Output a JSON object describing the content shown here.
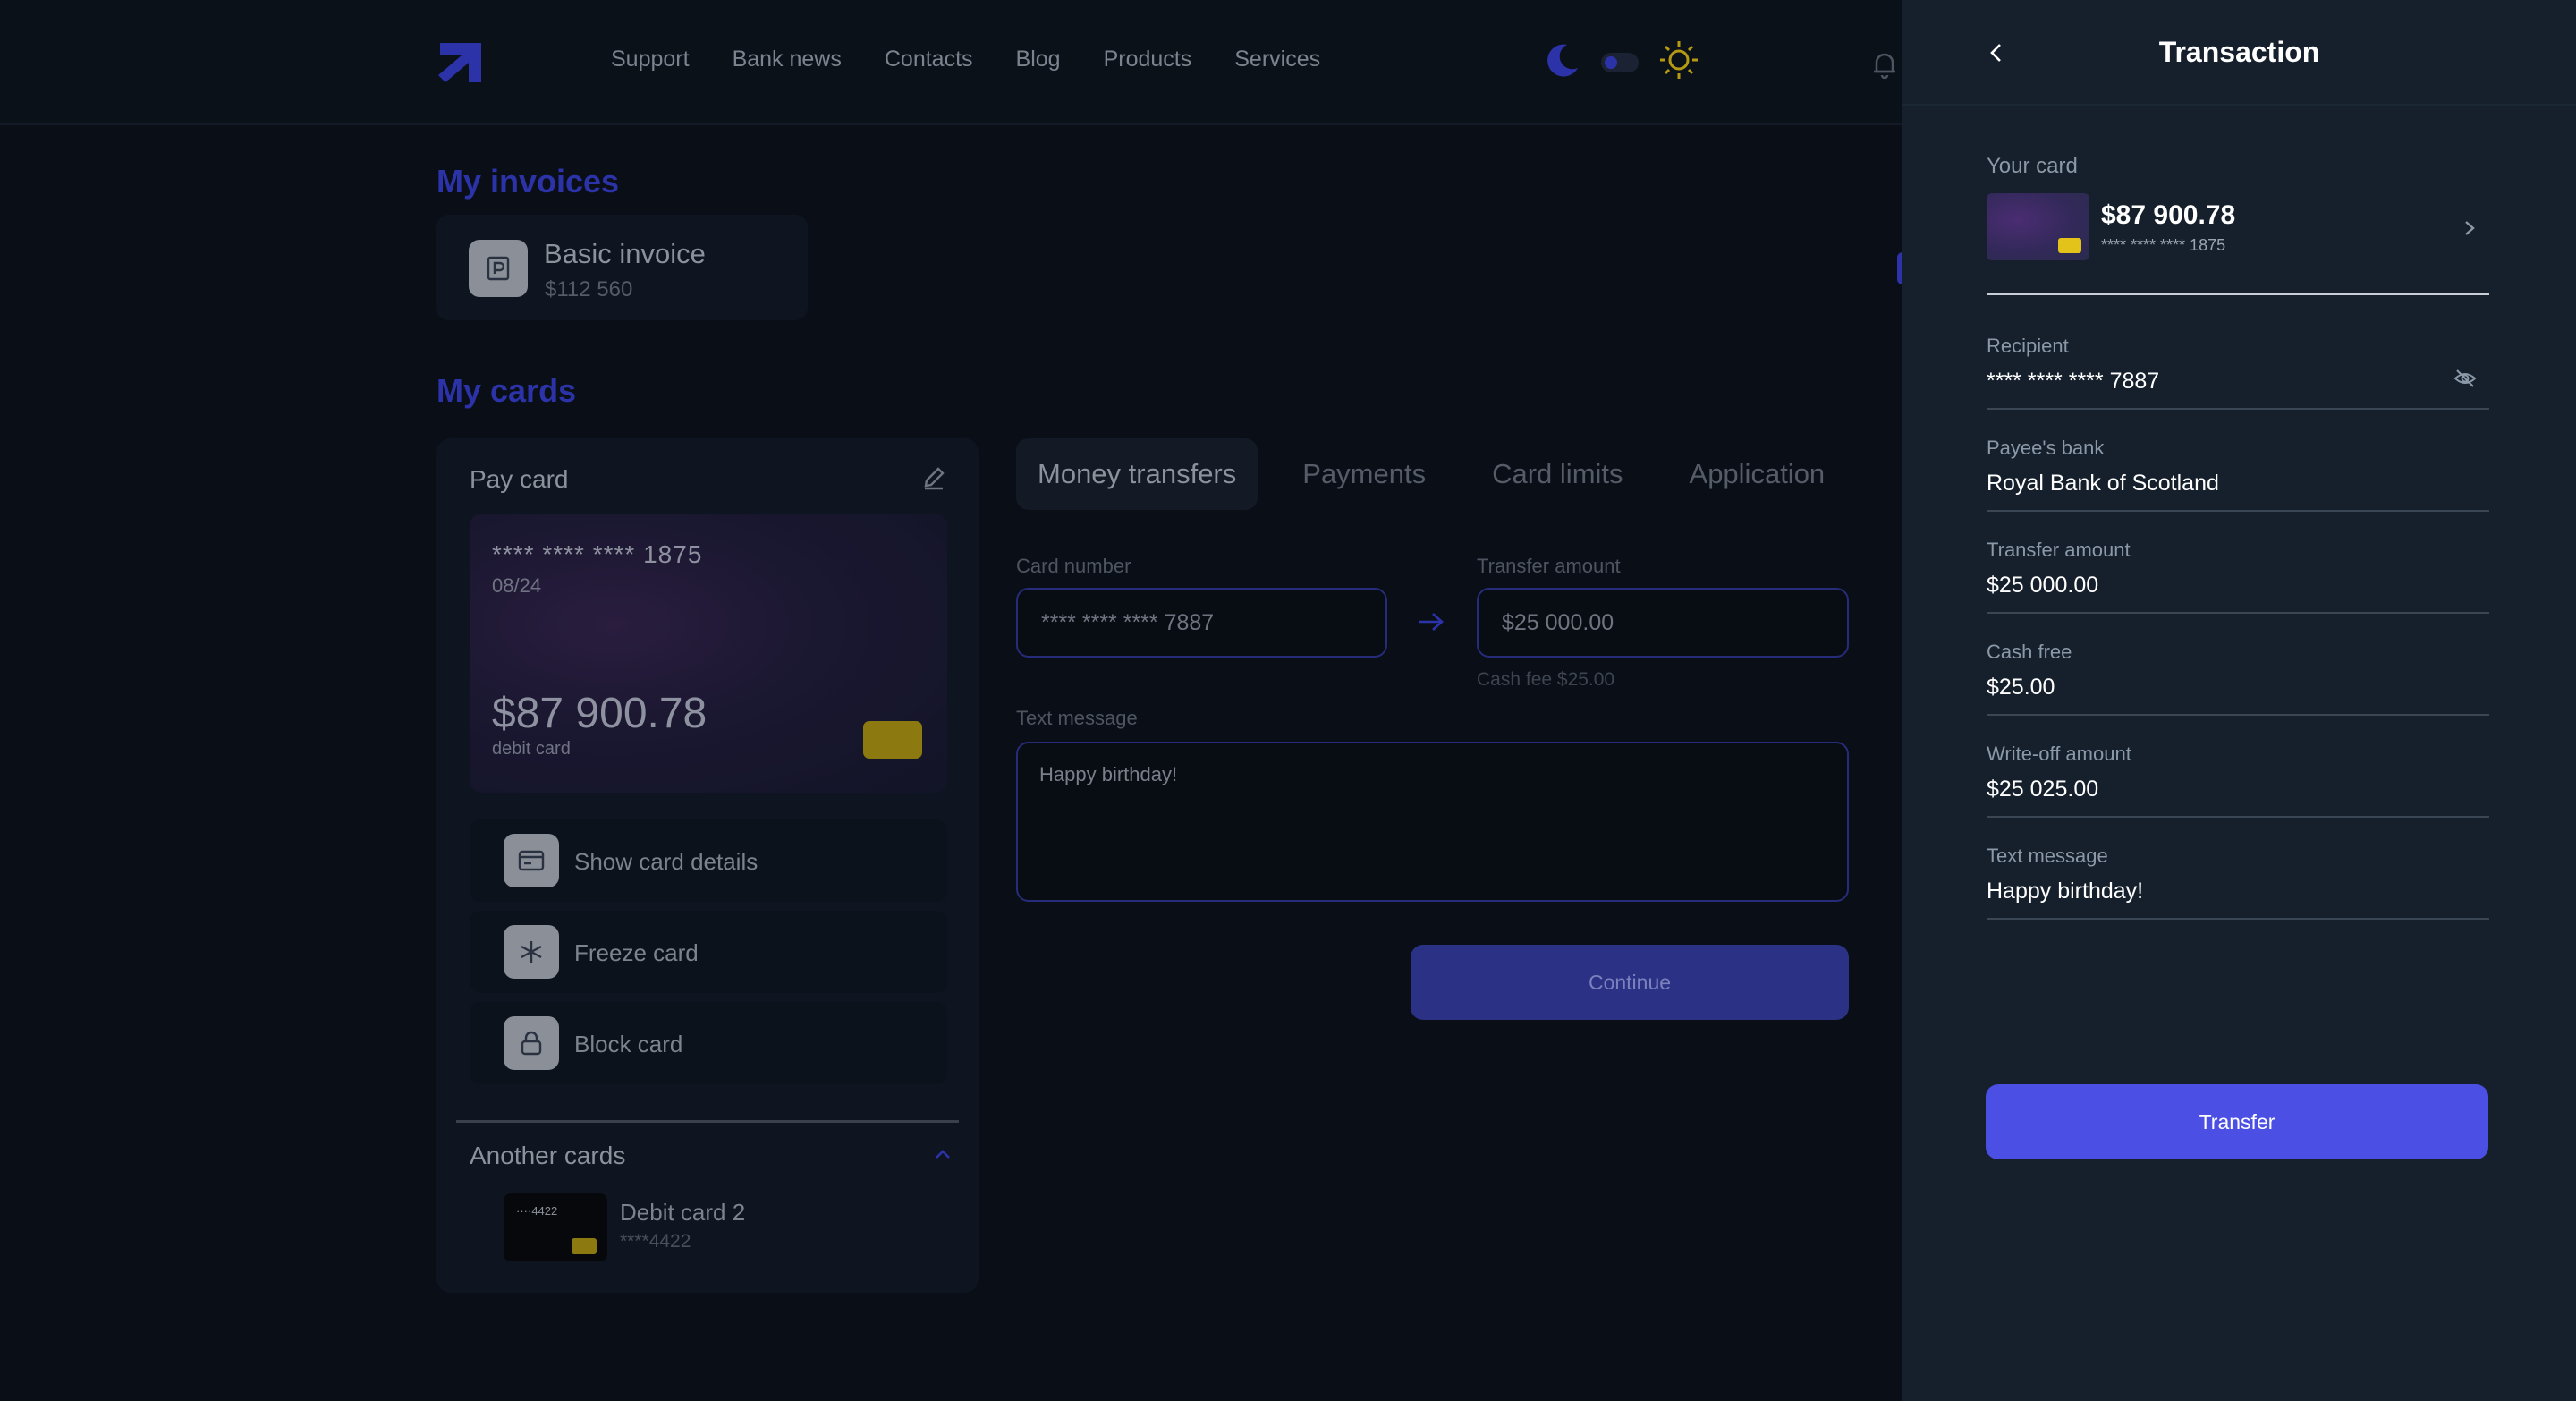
{
  "nav": {
    "items": [
      "Support",
      "Bank news",
      "Contacts",
      "Blog",
      "Products",
      "Services"
    ]
  },
  "invoices": {
    "title": "My invoices",
    "item": {
      "name": "Basic invoice",
      "amount": "$112 560"
    }
  },
  "cards": {
    "title": "My cards",
    "pay_card_label": "Pay card",
    "card": {
      "number": "**** **** **** 1875",
      "expiry": "08/24",
      "balance": "$87 900.78",
      "type": "debit card"
    },
    "actions": [
      "Show card details",
      "Freeze card",
      "Block card"
    ],
    "another_label": "Another cards",
    "another": {
      "name": "Debit card 2",
      "number": "****4422",
      "mini_number": "····4422"
    }
  },
  "transfer_form": {
    "tabs": [
      "Money transfers",
      "Payments",
      "Card limits",
      "Application"
    ],
    "card_number_label": "Card number",
    "card_number_value": "**** **** **** 7887",
    "amount_label": "Transfer amount",
    "amount_value": "$25 000.00",
    "fee_note": "Cash fee $25.00",
    "message_label": "Text message",
    "message_value": "Happy birthday!",
    "continue_label": "Continue"
  },
  "transaction": {
    "title": "Transaction",
    "your_card_label": "Your card",
    "your_card_balance": "$87 900.78",
    "your_card_number": "**** **** **** 1875",
    "fields": [
      {
        "label": "Recipient",
        "value": "**** **** **** 7887"
      },
      {
        "label": "Payee's bank",
        "value": "Royal Bank of Scotland"
      },
      {
        "label": "Transfer amount",
        "value": "$25 000.00"
      },
      {
        "label": "Cash free",
        "value": "$25.00"
      },
      {
        "label": "Write-off amount",
        "value": "$25 025.00"
      },
      {
        "label": "Text message",
        "value": "Happy birthday!"
      }
    ],
    "transfer_label": "Transfer"
  },
  "colors": {
    "accent": "#4b4fe4",
    "panel_bg": "#16202c",
    "chip": "#e3c21a"
  },
  "icons": {
    "logo": "arrow-up-right-logo",
    "theme_dark": "moon-icon",
    "theme_light": "sun-icon",
    "notifications": "bell-icon",
    "edit": "pencil-icon",
    "back": "chevron-left-icon",
    "hide_recipient": "eye-off-icon"
  }
}
